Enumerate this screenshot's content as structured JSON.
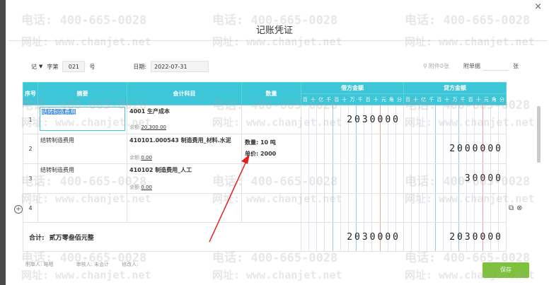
{
  "title": "记账凭证",
  "watermark": {
    "line1": "电话: 400-665-0028",
    "line2": "网址: www.chanjet.net"
  },
  "header": {
    "voucher_word": "记",
    "zi_label": "字第",
    "number": "021",
    "hao_label": "号",
    "date_label": "日期:",
    "date": "2022-07-31",
    "attachment": "附件0张",
    "attach_label": "附单据",
    "attach_unit": "张"
  },
  "columns": {
    "seq": "序号",
    "summary": "摘要",
    "account": "会计科目",
    "quantity": "数量",
    "debit": "借方金额",
    "credit": "贷方金额",
    "digit_units": [
      "百",
      "十",
      "亿",
      "千",
      "百",
      "十",
      "万",
      "千",
      "百",
      "十",
      "元",
      "角",
      "分"
    ]
  },
  "rows": [
    {
      "no": "1",
      "summary": "结转制造费用",
      "account": "4001 生产成本",
      "balance_label": "余额:",
      "balance": "20,300.00",
      "qty_line": "",
      "price_line": "",
      "debit": "2030000",
      "credit": ""
    },
    {
      "no": "2",
      "summary": "结转制造费用",
      "account": "410101.000543 制造费用_材料.水泥",
      "balance_label": "余额:",
      "balance": "0.00",
      "qty_line": "数量: 10 吨",
      "price_line": "单价: 2000",
      "debit": "",
      "credit": "2000000"
    },
    {
      "no": "3",
      "summary": "结转制造费用",
      "account": "410102 制造费用_人工",
      "balance_label": "余额:",
      "balance": "0.00",
      "qty_line": "",
      "price_line": "",
      "debit": "",
      "credit": "30000"
    },
    {
      "no": "4",
      "summary": "",
      "account": "",
      "balance_label": "",
      "balance": "",
      "qty_line": "",
      "price_line": "",
      "debit": "",
      "credit": ""
    }
  ],
  "total": {
    "label": "合计:",
    "text": "贰万零叁佰元整",
    "debit": "2030000",
    "credit": "2030000"
  },
  "footer": {
    "maker": "制单人: 略嗯",
    "auditor": "审核人: 未会计",
    "poster": "修改人:"
  },
  "save_label": "保存",
  "colors": {
    "header_bg": "#3dc5d8",
    "save": "#7dc13c",
    "arrow": "#e02020"
  }
}
